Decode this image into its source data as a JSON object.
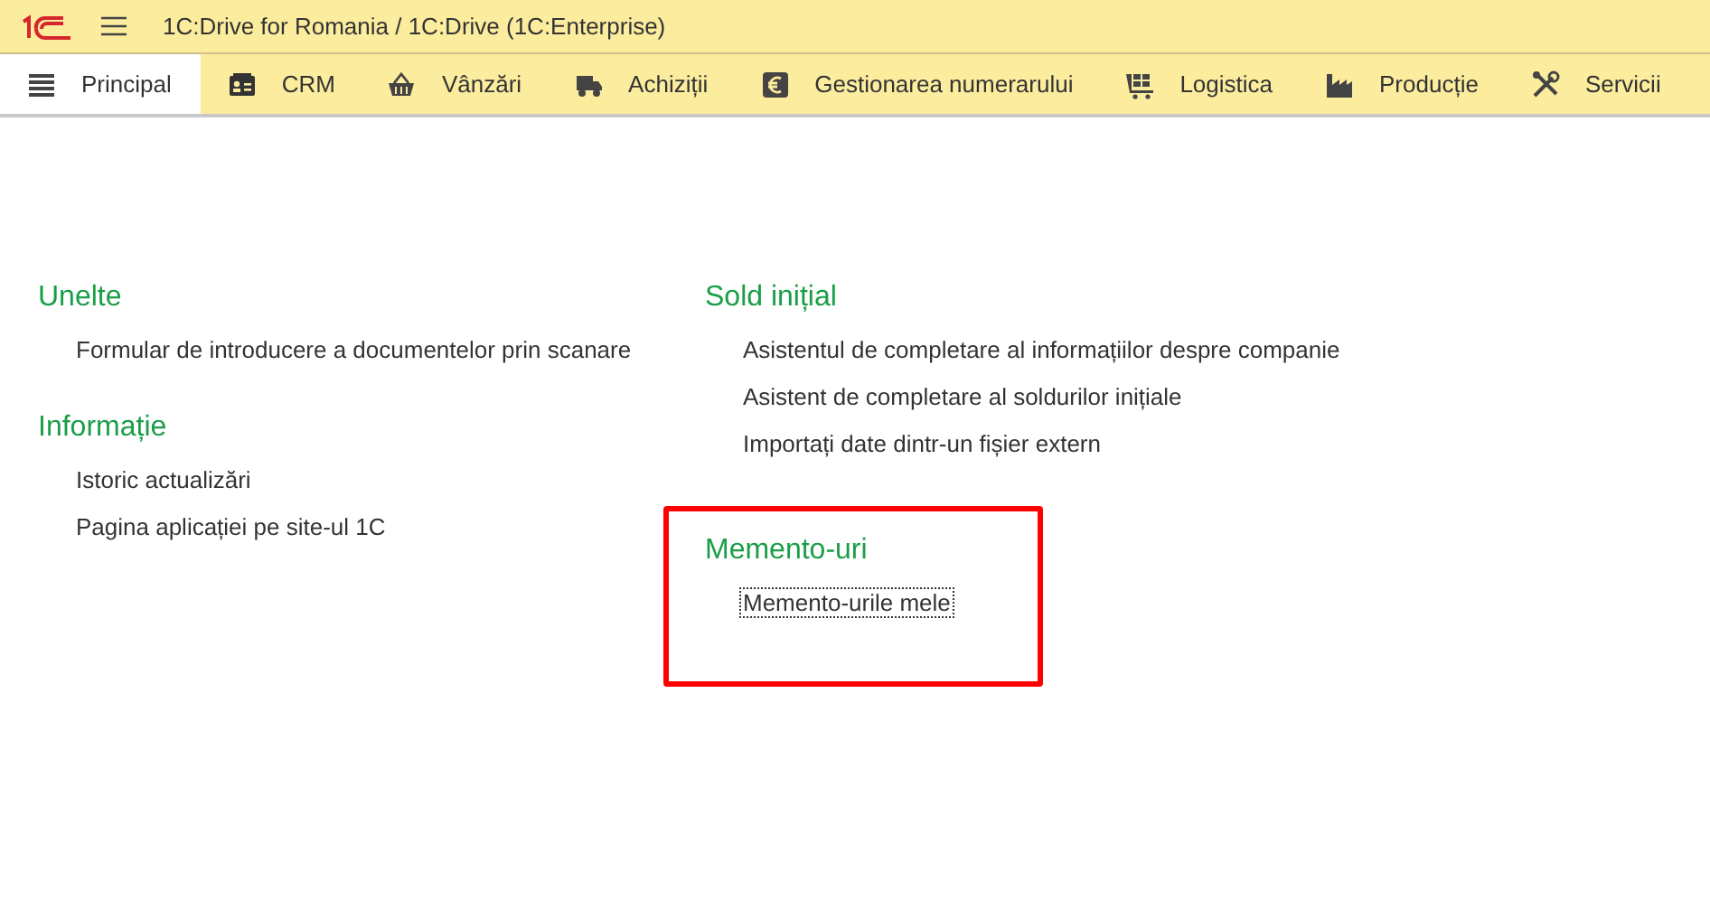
{
  "window": {
    "title": "1C:Drive for Romania / 1C:Drive  (1C:Enterprise)"
  },
  "tabs": [
    {
      "label": "Principal",
      "selected": true
    },
    {
      "label": "CRM",
      "selected": false
    },
    {
      "label": "Vânzări",
      "selected": false
    },
    {
      "label": "Achiziții",
      "selected": false
    },
    {
      "label": "Gestionarea numerarului",
      "selected": false
    },
    {
      "label": "Logistica",
      "selected": false
    },
    {
      "label": "Producție",
      "selected": false
    },
    {
      "label": "Servicii",
      "selected": false
    }
  ],
  "columns": [
    {
      "sections": [
        {
          "title": "Unelte",
          "highlighted": false,
          "items": [
            {
              "label": "Formular de introducere a documentelor prin scanare",
              "focused": false
            }
          ]
        },
        {
          "title": "Informație",
          "highlighted": false,
          "items": [
            {
              "label": "Istoric actualizări",
              "focused": false
            },
            {
              "label": "Pagina aplicației pe site-ul 1C",
              "focused": false
            }
          ]
        }
      ]
    },
    {
      "sections": [
        {
          "title": "Sold inițial",
          "highlighted": false,
          "items": [
            {
              "label": "Asistentul de completare al informațiilor despre companie",
              "focused": false
            },
            {
              "label": "Asistent de completare al soldurilor inițiale",
              "focused": false
            },
            {
              "label": "Importați date dintr-un fișier extern",
              "focused": false
            }
          ]
        },
        {
          "title": "Memento-uri",
          "highlighted": true,
          "items": [
            {
              "label": "Memento-urile mele",
              "focused": true
            }
          ]
        }
      ]
    }
  ]
}
